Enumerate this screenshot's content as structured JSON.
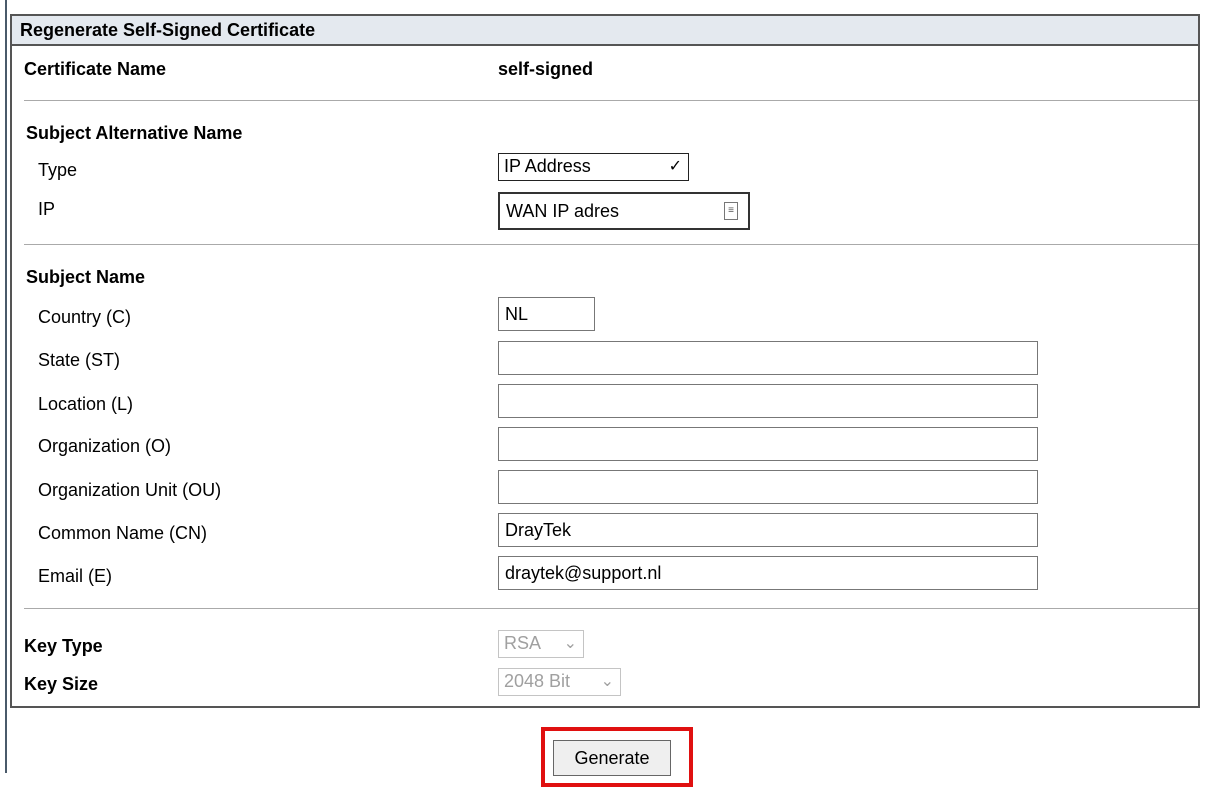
{
  "panel": {
    "title": "Regenerate Self-Signed Certificate",
    "certificate_name_label": "Certificate Name",
    "certificate_name_value": "self-signed"
  },
  "san": {
    "section_label": "Subject Alternative Name",
    "type_label": "Type",
    "type_value": "IP Address",
    "ip_label": "IP",
    "ip_value": "WAN IP adres"
  },
  "subject": {
    "section_label": "Subject Name",
    "country_label": "Country (C)",
    "country_value": "NL",
    "state_label": "State (ST)",
    "state_value": "",
    "location_label": "Location (L)",
    "location_value": "",
    "organization_label": "Organization (O)",
    "organization_value": "",
    "org_unit_label": "Organization Unit (OU)",
    "org_unit_value": "",
    "common_name_label": "Common Name (CN)",
    "common_name_value": "DrayTek",
    "email_label": "Email (E)",
    "email_value": "draytek@support.nl"
  },
  "key": {
    "type_label": "Key Type",
    "type_value": "RSA",
    "size_label": "Key Size",
    "size_value": "2048 Bit"
  },
  "actions": {
    "generate_label": "Generate"
  },
  "icons": {
    "dropdown": "chevron-down-icon",
    "ip_picker": "ip-object-picker-icon"
  },
  "colors": {
    "highlight": "#e01010",
    "title_bar": "#e4e9ef"
  }
}
